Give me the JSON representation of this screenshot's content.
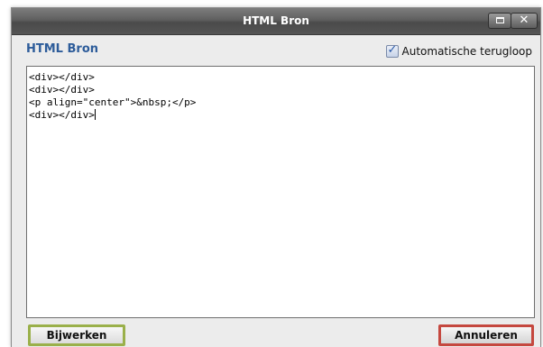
{
  "window": {
    "title": "HTML Bron"
  },
  "dialog": {
    "heading": "HTML Bron",
    "wrap_label": "Automatische terugloop",
    "wrap_checked": true
  },
  "editor": {
    "lines": [
      "<div></div>",
      "<div></div>",
      "<p align=\"center\">&nbsp;</p>",
      "<div></div>"
    ]
  },
  "buttons": {
    "update_label": "Bijwerken",
    "cancel_label": "Annuleren"
  },
  "colors": {
    "heading": "#2d5c9a",
    "update_border": "#9ab04a",
    "cancel_border": "#c5483f",
    "titlebar": "#5f5f5f"
  }
}
